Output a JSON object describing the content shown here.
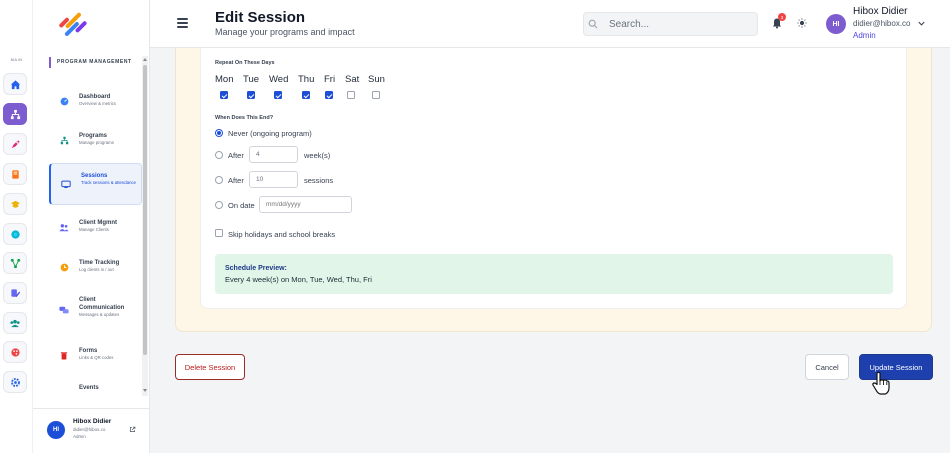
{
  "header": {
    "title": "Edit Session",
    "subtitle": "Manage your programs and impact",
    "search_placeholder": "Search...",
    "notification_count": "3",
    "user": {
      "initials": "HI",
      "name": "Hibox Didier",
      "email": "didier@hibox.co",
      "role": "Admin"
    }
  },
  "rail": {
    "section_label": "MAIN",
    "icons": [
      "home-icon",
      "hierarchy-icon",
      "rocket-icon",
      "book-icon",
      "graduation-cap-icon",
      "globe-icon",
      "flow-icon",
      "edit-user-icon",
      "group-icon",
      "palette-icon",
      "gear-icon"
    ]
  },
  "sidebar": {
    "section_title": "PROGRAM MANAGEMENT",
    "items": [
      {
        "title": "Dashboard",
        "subtitle": "Overview & metrics"
      },
      {
        "title": "Programs",
        "subtitle": "Manage programs"
      },
      {
        "title": "Sessions",
        "subtitle": "Track sessions & attendance"
      },
      {
        "title": "Client Mgmnt",
        "subtitle": "Manage Clients"
      },
      {
        "title": "Time Tracking",
        "subtitle": "Log clients in / out"
      },
      {
        "title": "Client Communication",
        "subtitle": "Messages & updates"
      },
      {
        "title": "Forms",
        "subtitle": "Links & QR codes"
      },
      {
        "title": "Events",
        "subtitle": ""
      }
    ],
    "user": {
      "initials": "HI",
      "name": "Hibox Didier",
      "email": "didier@hibox.co",
      "role": "Admin"
    }
  },
  "form": {
    "days_label": "Repeat On These Days",
    "days": [
      {
        "label": "Mon",
        "checked": true
      },
      {
        "label": "Tue",
        "checked": true
      },
      {
        "label": "Wed",
        "checked": true
      },
      {
        "label": "Thu",
        "checked": true
      },
      {
        "label": "Fri",
        "checked": true
      },
      {
        "label": "Sat",
        "checked": false
      },
      {
        "label": "Sun",
        "checked": false
      }
    ],
    "end_label": "When Does This End?",
    "end_options": {
      "never": "Never (ongoing program)",
      "after_weeks_prefix": "After",
      "after_weeks_value": "4",
      "after_weeks_suffix": "week(s)",
      "after_sessions_prefix": "After",
      "after_sessions_value": "10",
      "after_sessions_suffix": "sessions",
      "on_date": "On date",
      "date_placeholder": "mm/dd/yyyy"
    },
    "selected_end": "never",
    "skip_label": "Skip holidays and school breaks",
    "skip_checked": false,
    "preview_title": "Schedule Preview:",
    "preview_text": "Every 4 week(s) on Mon, Tue, Wed, Thu, Fri"
  },
  "actions": {
    "delete": "Delete Session",
    "cancel": "Cancel",
    "update": "Update Session"
  },
  "colors": {
    "accent": "#7c5ccf",
    "primary": "#1e40af",
    "danger": "#b91c1c",
    "preview_bg": "#e1f5e9",
    "card_bg": "#fef6e6"
  }
}
